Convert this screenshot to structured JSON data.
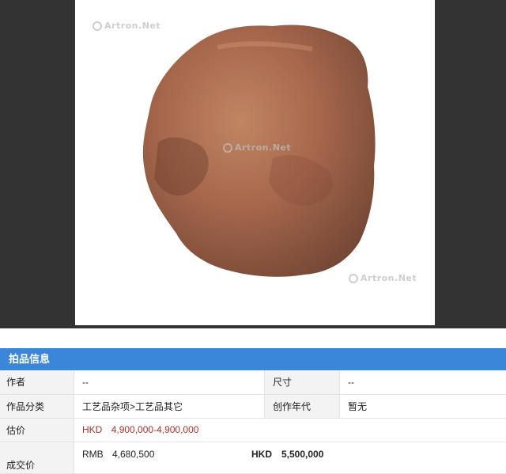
{
  "watermark": {
    "text": "Artron.Net"
  },
  "panel": {
    "title": "拍品信息",
    "rows": {
      "author": {
        "label": "作者",
        "value": "--"
      },
      "size": {
        "label": "尺寸",
        "value": "--"
      },
      "category": {
        "label": "作品分类",
        "value": "工艺品杂项>工艺品其它"
      },
      "year": {
        "label": "创作年代",
        "value": "暂无"
      },
      "estimate": {
        "label": "估价",
        "currency": "HKD",
        "value": "4,900,000-4,900,000"
      },
      "price": {
        "label": "成交价",
        "rmb_currency": "RMB",
        "rmb_value": "4,680,500",
        "hkd_currency": "HKD",
        "hkd_value": "5,500,000"
      }
    }
  },
  "colors": {
    "header": "#3b86d8",
    "estimate": "#b0302a"
  }
}
